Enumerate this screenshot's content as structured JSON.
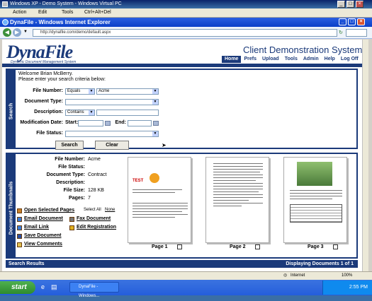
{
  "vpc": {
    "title": "Windows XP - Demo System - Windows Virtual PC",
    "menu": [
      "Action",
      "Edit",
      "Tools",
      "Ctrl+Alt+Del"
    ]
  },
  "ie": {
    "title": "DynaFile - Windows Internet Explorer",
    "url": "http://dynafile.com/demo/default.aspx"
  },
  "brand": {
    "logo": "DynaFile",
    "tagline": "Dynamic Document Management System",
    "system_title": "Client Demonstration System"
  },
  "nav": [
    "Home",
    "Prefs",
    "Upload",
    "Tools",
    "Admin",
    "Help",
    "Log Off"
  ],
  "search": {
    "tab": "Search",
    "welcome": "Welcome Brian McBerry.",
    "instructions": "Please enter your search criteria below:",
    "labels": {
      "file_number": "File Number:",
      "document_type": "Document Type:",
      "description": "Description:",
      "modification_date": "Modification Date:",
      "start": "Start:",
      "end": "End:",
      "file_status": "File Status:"
    },
    "file_number_op": "Equals",
    "file_number_val": "Acme",
    "description_op": "Contains",
    "search_button": "Search",
    "clear_button": "Clear"
  },
  "thumbs": {
    "tab": "Document Thumbnails",
    "info_labels": {
      "file_number": "File Number:",
      "file_status": "File Status:",
      "document_type": "Document Type:",
      "description": "Description:",
      "file_size": "File Size:",
      "pages": "Pages:"
    },
    "info_values": {
      "file_number": "Acme",
      "file_status": "",
      "document_type": "Contract",
      "description": "",
      "file_size": "128 KB",
      "pages": "7"
    },
    "open_selected": "Open Selected Pages",
    "select_all": "Select All",
    "none": "None",
    "actions": [
      "Email Document",
      "Fax Document",
      "Email Link",
      "Edit Registration",
      "Save Document",
      "View Comments"
    ],
    "pages": [
      "Page 1",
      "Page 2",
      "Page 3"
    ]
  },
  "status": {
    "left": "Search Results",
    "right": "Displaying Documents 1 of 1"
  },
  "ie_status": {
    "zone": "Internet",
    "zoom": "100%"
  },
  "taskbar": {
    "start": "start",
    "task": "DynaFile - Windows...",
    "clock": "2:55 PM"
  }
}
